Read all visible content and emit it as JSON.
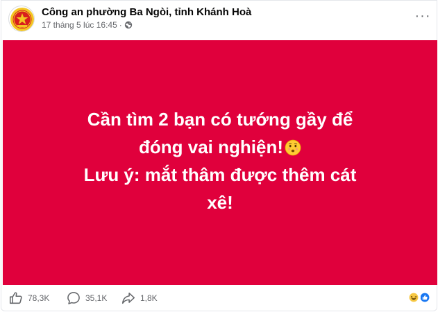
{
  "post": {
    "page_name": "Công an phường Ba Ngòi, tỉnh Khánh Hoà",
    "timestamp": "17 tháng 5 lúc 16:45",
    "separator": "·",
    "more_label": "···",
    "text_line1": "Cần tìm 2 bạn có tướng gầy để đóng vai nghiện!",
    "text_line2": "Lưu ý: mắt thâm được thêm cát xê!",
    "background_color": "#e0003c"
  },
  "footer": {
    "likes": "78,3K",
    "comments": "35,1K",
    "shares": "1,8K"
  },
  "icons": {
    "avatar": "police-emblem-icon",
    "privacy": "globe-icon",
    "more": "more-horizontal-icon",
    "emoji": "shushing-face-emoji",
    "like": "thumbs-up-icon",
    "comment": "comment-bubble-icon",
    "share": "share-arrow-icon",
    "reactions": [
      "haha-reaction-icon",
      "like-reaction-icon"
    ]
  }
}
